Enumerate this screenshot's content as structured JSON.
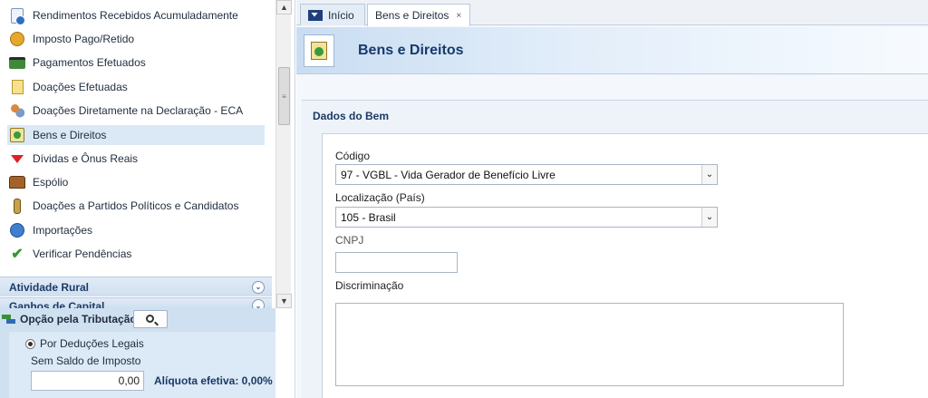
{
  "sidebar": {
    "items": [
      {
        "label": "Rendimentos Recebidos Acumuladamente",
        "icon": "document-info-icon"
      },
      {
        "label": "Imposto Pago/Retido",
        "icon": "coin-hand-icon"
      },
      {
        "label": "Pagamentos Efetuados",
        "icon": "card-icon"
      },
      {
        "label": "Doações Efetuadas",
        "icon": "gift-document-icon"
      },
      {
        "label": "Doações Diretamente na Declaração - ECA",
        "icon": "people-icon"
      },
      {
        "label": "Bens e Direitos",
        "icon": "bens-icon"
      },
      {
        "label": "Dívidas e Ônus Reais",
        "icon": "red-arrow-down-icon"
      },
      {
        "label": "Espólio",
        "icon": "chest-icon"
      },
      {
        "label": "Doações a Partidos Políticos e Candidatos",
        "icon": "bottle-icon"
      },
      {
        "label": "Importações",
        "icon": "import-icon"
      },
      {
        "label": "Verificar Pendências",
        "icon": "checkmark-icon"
      }
    ],
    "active_index": 5,
    "sections": [
      {
        "label": "Atividade Rural"
      },
      {
        "label": "Ganhos de Capital"
      }
    ]
  },
  "tax_panel": {
    "title": "Opção pela Tributação:",
    "option_label": "Por Deduções Legais",
    "saldo_label": "Sem Saldo de Imposto",
    "saldo_value": "0,00",
    "aliquota": "Alíquota efetiva: 0,00%"
  },
  "tabs": [
    {
      "label": "Início"
    },
    {
      "label": "Bens e Direitos",
      "close": "×"
    }
  ],
  "page": {
    "title": "Bens e Direitos",
    "section_title": "Dados do Bem"
  },
  "form": {
    "codigo_label": "Código",
    "codigo_value": "97 - VGBL - Vida Gerador de Benefício Livre",
    "localizacao_label": "Localização (País)",
    "localizacao_value": "105 - Brasil",
    "cnpj_label": "CNPJ",
    "cnpj_value": "",
    "discriminacao_label": "Discriminação",
    "discriminacao_value": ""
  },
  "colors": {
    "accent": "#173a6b",
    "active_item_bg": "#dbe8f6",
    "panel_bg": "#cfe0f1"
  }
}
